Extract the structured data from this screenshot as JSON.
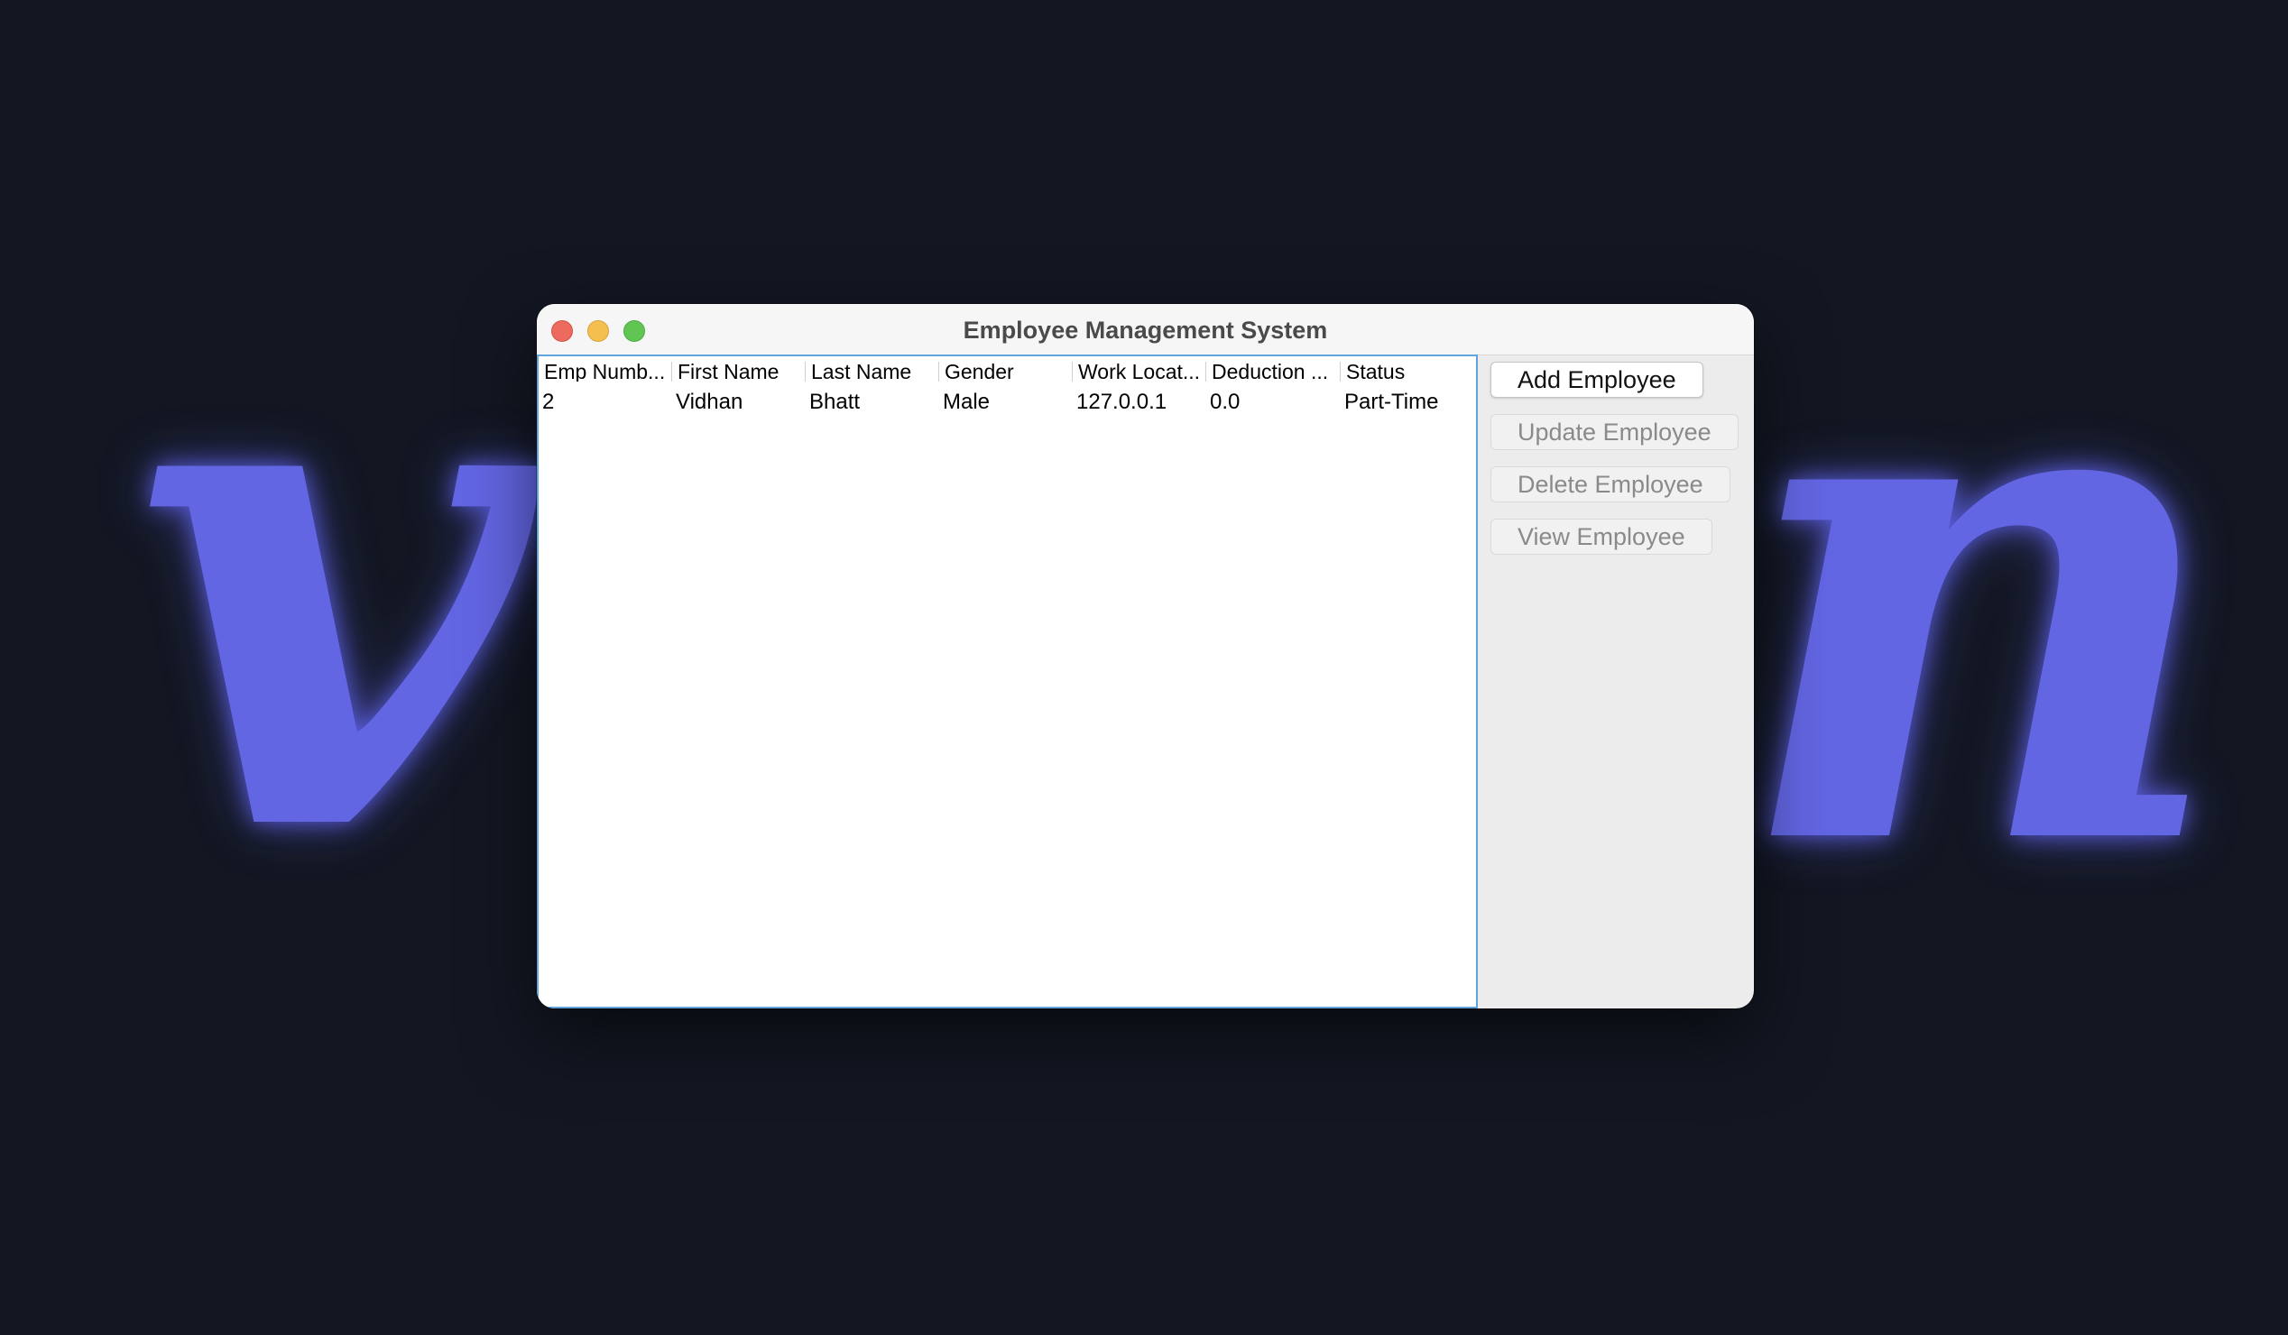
{
  "wallpaper": {
    "left_glyph": "v",
    "right_glyph": "n",
    "accent_color": "#6366e3",
    "background_color": "#131722"
  },
  "window": {
    "title": "Employee Management System"
  },
  "table": {
    "headers": [
      "Emp Numb...",
      "First Name",
      "Last Name",
      "Gender",
      "Work Locat...",
      "Deduction ...",
      "Status"
    ],
    "rows": [
      [
        "2",
        "Vidhan",
        "Bhatt",
        "Male",
        "127.0.0.1",
        "0.0",
        "Part-Time"
      ]
    ]
  },
  "buttons": {
    "add": "Add Employee",
    "update": "Update Employee",
    "delete": "Delete Employee",
    "view": "View Employee"
  },
  "colors": {
    "close": "#ec6a5e",
    "minimize": "#f4bf4f",
    "zoom": "#61c554",
    "focus_border": "#5fa4dc"
  }
}
